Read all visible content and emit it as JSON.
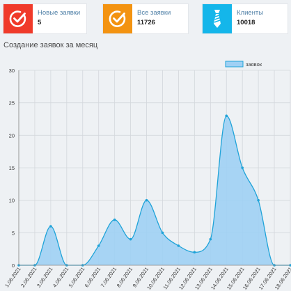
{
  "cards": [
    {
      "title": "Новые заявки",
      "value": "5",
      "color": "#f03a2a",
      "icon": "checkmark-circle-icon"
    },
    {
      "title": "Все заявки",
      "value": "11726",
      "color": "#f39311",
      "icon": "checkmark-circle-icon"
    },
    {
      "title": "Клиенты",
      "value": "10018",
      "color": "#14b6ea",
      "icon": "necktie-icon"
    }
  ],
  "section_title": "Создание заявок за месяц",
  "chart_data": {
    "type": "area",
    "categories": [
      "1.06.2021",
      "2.06.2021",
      "3.06.2021",
      "4.06.2021",
      "5.06.2021",
      "6.06.2021",
      "7.06.2021",
      "8.06.2021",
      "9.06.2021",
      "10.06.2021",
      "11.06.2021",
      "12.06.2021",
      "13.06.2021",
      "14.06.2021",
      "15.06.2021",
      "16.06.2021",
      "17.06.2021",
      "18.06.2021"
    ],
    "series": [
      {
        "name": "заявок",
        "values": [
          0,
          0,
          6,
          0,
          0,
          3,
          7,
          4,
          10,
          5,
          3,
          2,
          4,
          23,
          15,
          10,
          0,
          0
        ]
      }
    ],
    "ylim": [
      0,
      30
    ],
    "yticks": [
      0,
      5,
      10,
      15,
      20,
      25,
      30
    ],
    "grid": true,
    "legend": "top-right",
    "colors": {
      "fill": "#9fd0f4",
      "line": "#1fa3d8",
      "point": "#1fa3d8"
    }
  }
}
